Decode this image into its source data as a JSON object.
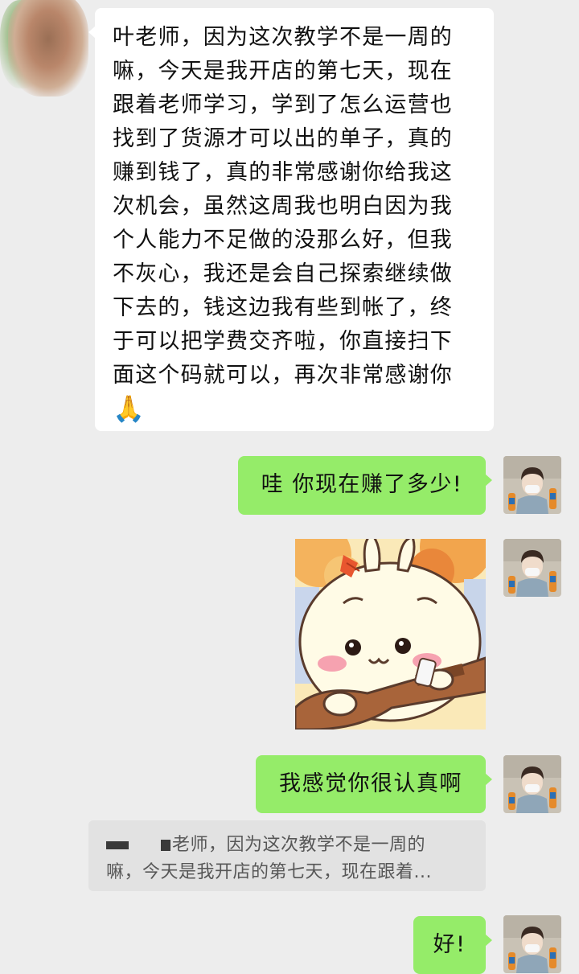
{
  "chat": {
    "messages": [
      {
        "side": "left",
        "text": "叶老师，因为这次教学不是一周的嘛，今天是我开店的第七天，现在跟着老师学习，学到了怎么运营也找到了货源才可以出的单子，真的赚到钱了，真的非常感谢你给我这次机会，虽然这周我也明白因为我个人能力不足做的没那么好，但我不灰心，我还是会自己探索继续做下去的，钱这边我有些到帐了，终于可以把学费交齐啦，你直接扫下面这个码就可以，再次非常感谢你",
        "lines": [
          "叶老师，因为这次教学不是一周的",
          "嘛，今天是我开店的第七天，现在",
          "跟着老师学习，学到了怎么运营也",
          "找到了货源才可以出的单子，真的",
          "赚到钱了，真的非常感谢你给我这",
          "次机会，虽然这周我也明白因为我",
          "个人能力不足做的没那么好，但我",
          "不灰心，我还是会自己探索继续做",
          "下去的，钱这边我有些到帐了，终",
          "于可以把学费交齐啦，你直接扫下",
          "面这个码就可以，再次非常感谢你"
        ],
        "emoji": "🙏"
      },
      {
        "side": "right",
        "text": "哇 你现在赚了多少!"
      },
      {
        "side": "right",
        "type": "sticker",
        "icon": "bunny-playing-guitar-sticker"
      },
      {
        "side": "right",
        "text": "我感觉你很认真啊"
      },
      {
        "side": "right",
        "text": "好!"
      }
    ],
    "quote": {
      "line1": "老师，因为这次教学不是一周的",
      "line2": "嘛，今天是我开店的第七天，现在跟着..."
    }
  },
  "colors": {
    "background": "#ededed",
    "incoming_bubble": "#ffffff",
    "outgoing_bubble": "#95ec69",
    "quote_background": "#e2e2e2"
  }
}
